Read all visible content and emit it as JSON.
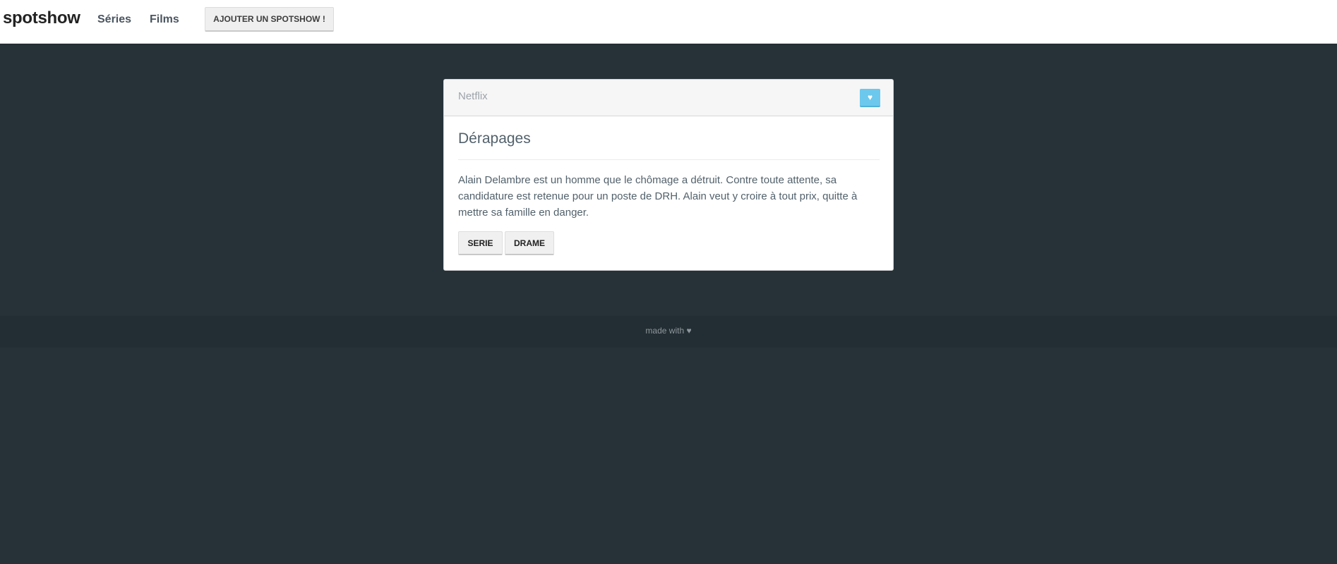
{
  "navbar": {
    "brand": "spotshow",
    "links": [
      {
        "label": "Séries"
      },
      {
        "label": "Films"
      }
    ],
    "add_button_label": "AJOUTER UN SPOTSHOW !"
  },
  "card": {
    "provider": "Netflix",
    "favorite_icon": "heart-icon",
    "favorite_glyph": "♥",
    "title": "Dérapages",
    "description": "Alain Delambre est un homme que le chômage a détruit. Contre toute attente, sa candidature est retenue pour un poste de DRH. Alain veut y croire à tout prix, quitte à mettre sa famille en danger.",
    "tags": [
      {
        "label": "SERIE"
      },
      {
        "label": "DRAME"
      }
    ]
  },
  "footer": {
    "text": "made with ♥"
  },
  "colors": {
    "background": "#263238",
    "footer_background": "#232e34",
    "accent": "#6cc8ec",
    "text": "#52616b"
  }
}
